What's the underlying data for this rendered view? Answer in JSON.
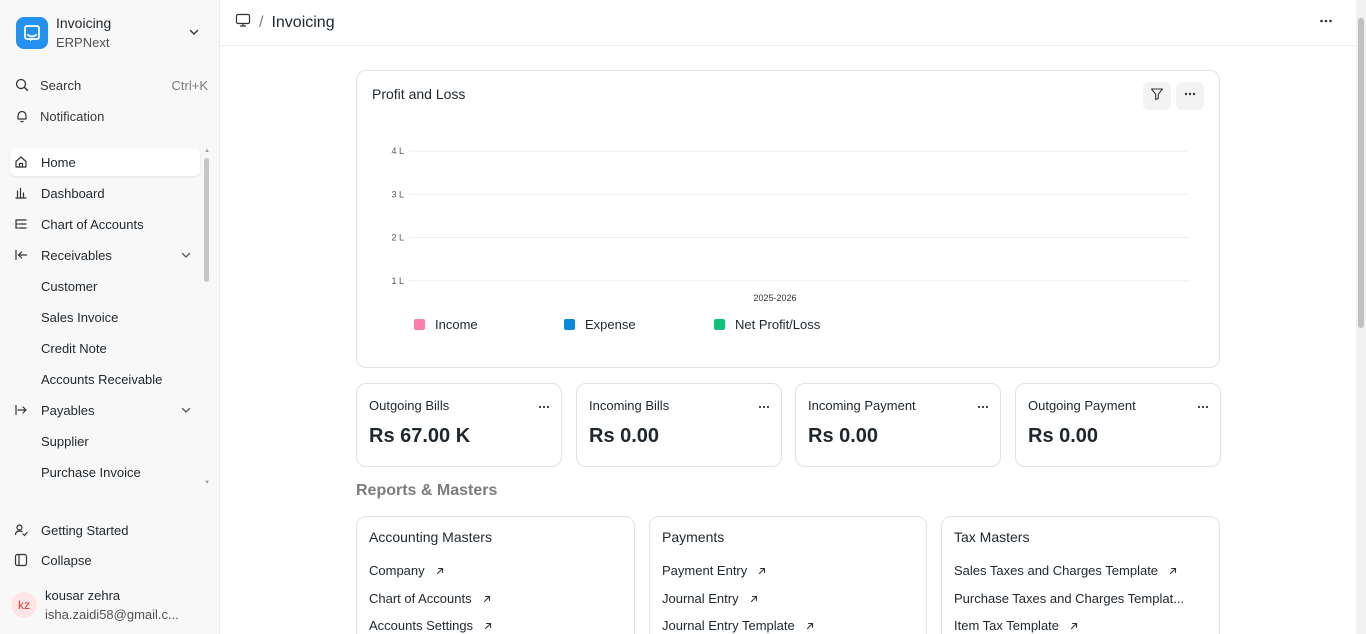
{
  "app": {
    "title": "Invoicing",
    "subtitle": "ERPNext"
  },
  "utility": {
    "search_label": "Search",
    "search_shortcut": "Ctrl+K",
    "notification_label": "Notification"
  },
  "sidebar": {
    "items": [
      {
        "label": "Home"
      },
      {
        "label": "Dashboard"
      },
      {
        "label": "Chart of Accounts"
      },
      {
        "label": "Receivables"
      },
      {
        "label": "Customer"
      },
      {
        "label": "Sales Invoice"
      },
      {
        "label": "Credit Note"
      },
      {
        "label": "Accounts Receivable"
      },
      {
        "label": "Payables"
      },
      {
        "label": "Supplier"
      },
      {
        "label": "Purchase Invoice"
      }
    ],
    "getting_started": "Getting Started",
    "collapse": "Collapse",
    "user": {
      "initials": "kz",
      "name": "kousar zehra",
      "email": "isha.zaidi58@gmail.c..."
    }
  },
  "header": {
    "separator": "/",
    "title": "Invoicing"
  },
  "chart_card": {
    "title": "Profit and Loss"
  },
  "chart_data": {
    "type": "bar",
    "categories": [
      "2025-2026"
    ],
    "series": [
      {
        "name": "Income",
        "values": [
          0
        ],
        "color": "#ff7ea8"
      },
      {
        "name": "Expense",
        "values": [
          0
        ],
        "color": "#0b88d8"
      },
      {
        "name": "Net Profit/Loss",
        "values": [
          0
        ],
        "color": "#10c17e"
      }
    ],
    "y_ticks": [
      "1 L",
      "2 L",
      "3 L",
      "4 L"
    ],
    "y_tick_values": [
      100000,
      200000,
      300000,
      400000
    ],
    "ylim": [
      0,
      400000
    ],
    "grid": true,
    "legend_position": "bottom"
  },
  "number_cards": [
    {
      "title": "Outgoing Bills",
      "value": "Rs 67.00 K"
    },
    {
      "title": "Incoming Bills",
      "value": "Rs 0.00"
    },
    {
      "title": "Incoming Payment",
      "value": "Rs 0.00"
    },
    {
      "title": "Outgoing Payment",
      "value": "Rs 0.00"
    }
  ],
  "reports_section": {
    "title": "Reports & Masters",
    "cards": [
      {
        "title": "Accounting Masters",
        "links": [
          "Company",
          "Chart of Accounts",
          "Accounts Settings"
        ]
      },
      {
        "title": "Payments",
        "links": [
          "Payment Entry",
          "Journal Entry",
          "Journal Entry Template"
        ]
      },
      {
        "title": "Tax Masters",
        "links": [
          "Sales Taxes and Charges Template",
          "Purchase Taxes and Charges Templat...",
          "Item Tax Template"
        ]
      }
    ]
  }
}
